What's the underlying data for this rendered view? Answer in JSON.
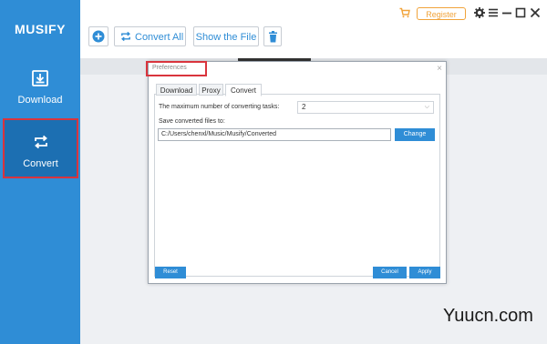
{
  "app": {
    "brand": "MUSIFY"
  },
  "sidebar": {
    "items": [
      {
        "label": "Download",
        "icon": "download-icon"
      },
      {
        "label": "Convert",
        "icon": "convert-icon",
        "active": true
      }
    ]
  },
  "toolbar": {
    "convert_all_label": "Convert All",
    "show_file_label": "Show the File",
    "register_label": "Register"
  },
  "dialog": {
    "title": "Preferences",
    "close_glyph": "×",
    "tabs": [
      {
        "label": "Download"
      },
      {
        "label": "Proxy"
      },
      {
        "label": "Convert",
        "active": true
      }
    ],
    "max_tasks_label": "The maximum number of converting tasks:",
    "max_tasks_value": "2",
    "save_label": "Save converted files to:",
    "save_path": "C:/Users/chenxl/Music/Musify/Converted",
    "change_label": "Change",
    "reset_label": "Reset",
    "cancel_label": "Cancel",
    "apply_label": "Apply"
  },
  "watermark": "Yuucn.com",
  "colors": {
    "accent": "#2f8dd6",
    "highlight_border": "#d9343d",
    "register": "#f1a33a"
  }
}
